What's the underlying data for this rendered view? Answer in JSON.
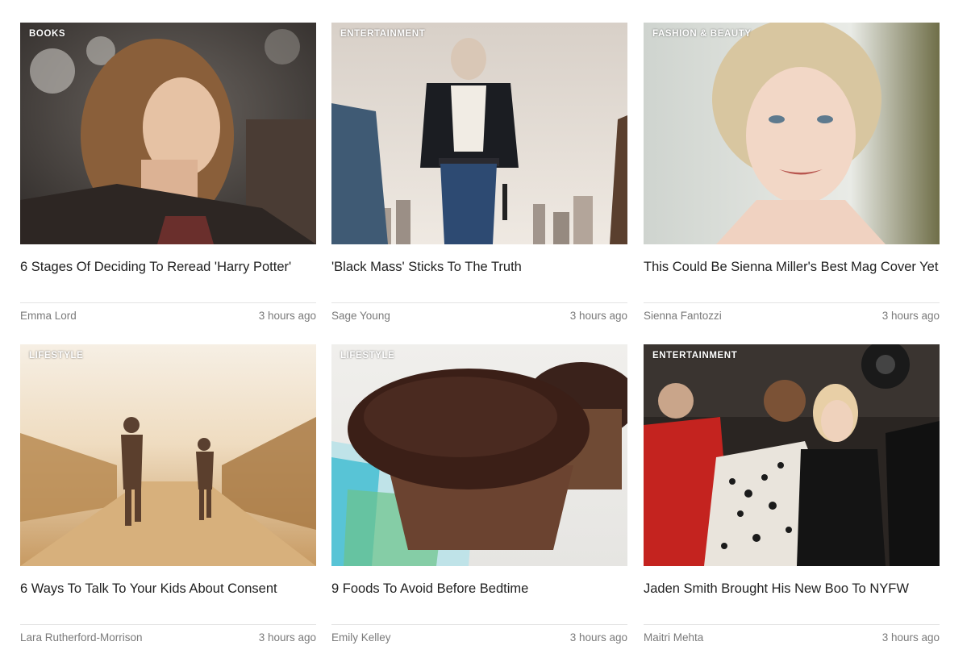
{
  "cards": [
    {
      "category": "BOOKS",
      "title": "6 Stages Of Deciding To Reread 'Harry Potter'",
      "author": "Emma Lord",
      "time": "3 hours ago"
    },
    {
      "category": "ENTERTAINMENT",
      "title": "'Black Mass' Sticks To The Truth",
      "author": "Sage Young",
      "time": "3 hours ago"
    },
    {
      "category": "FASHION & BEAUTY",
      "title": "This Could Be Sienna Miller's Best Mag Cover Yet",
      "author": "Sienna Fantozzi",
      "time": "3 hours ago"
    },
    {
      "category": "LIFESTYLE",
      "title": "6 Ways To Talk To Your Kids About Consent",
      "author": "Lara Rutherford-Morrison",
      "time": "3 hours ago"
    },
    {
      "category": "LIFESTYLE",
      "title": "9 Foods To Avoid Before Bedtime",
      "author": "Emily Kelley",
      "time": "3 hours ago"
    },
    {
      "category": "ENTERTAINMENT",
      "title": "Jaden Smith Brought His New Boo To NYFW",
      "author": "Maitri Mehta",
      "time": "3 hours ago"
    }
  ],
  "colors": {
    "text": "#222222",
    "meta": "#7a7a7a",
    "rule": "#e4e4e4",
    "tag": "#ffffff"
  }
}
